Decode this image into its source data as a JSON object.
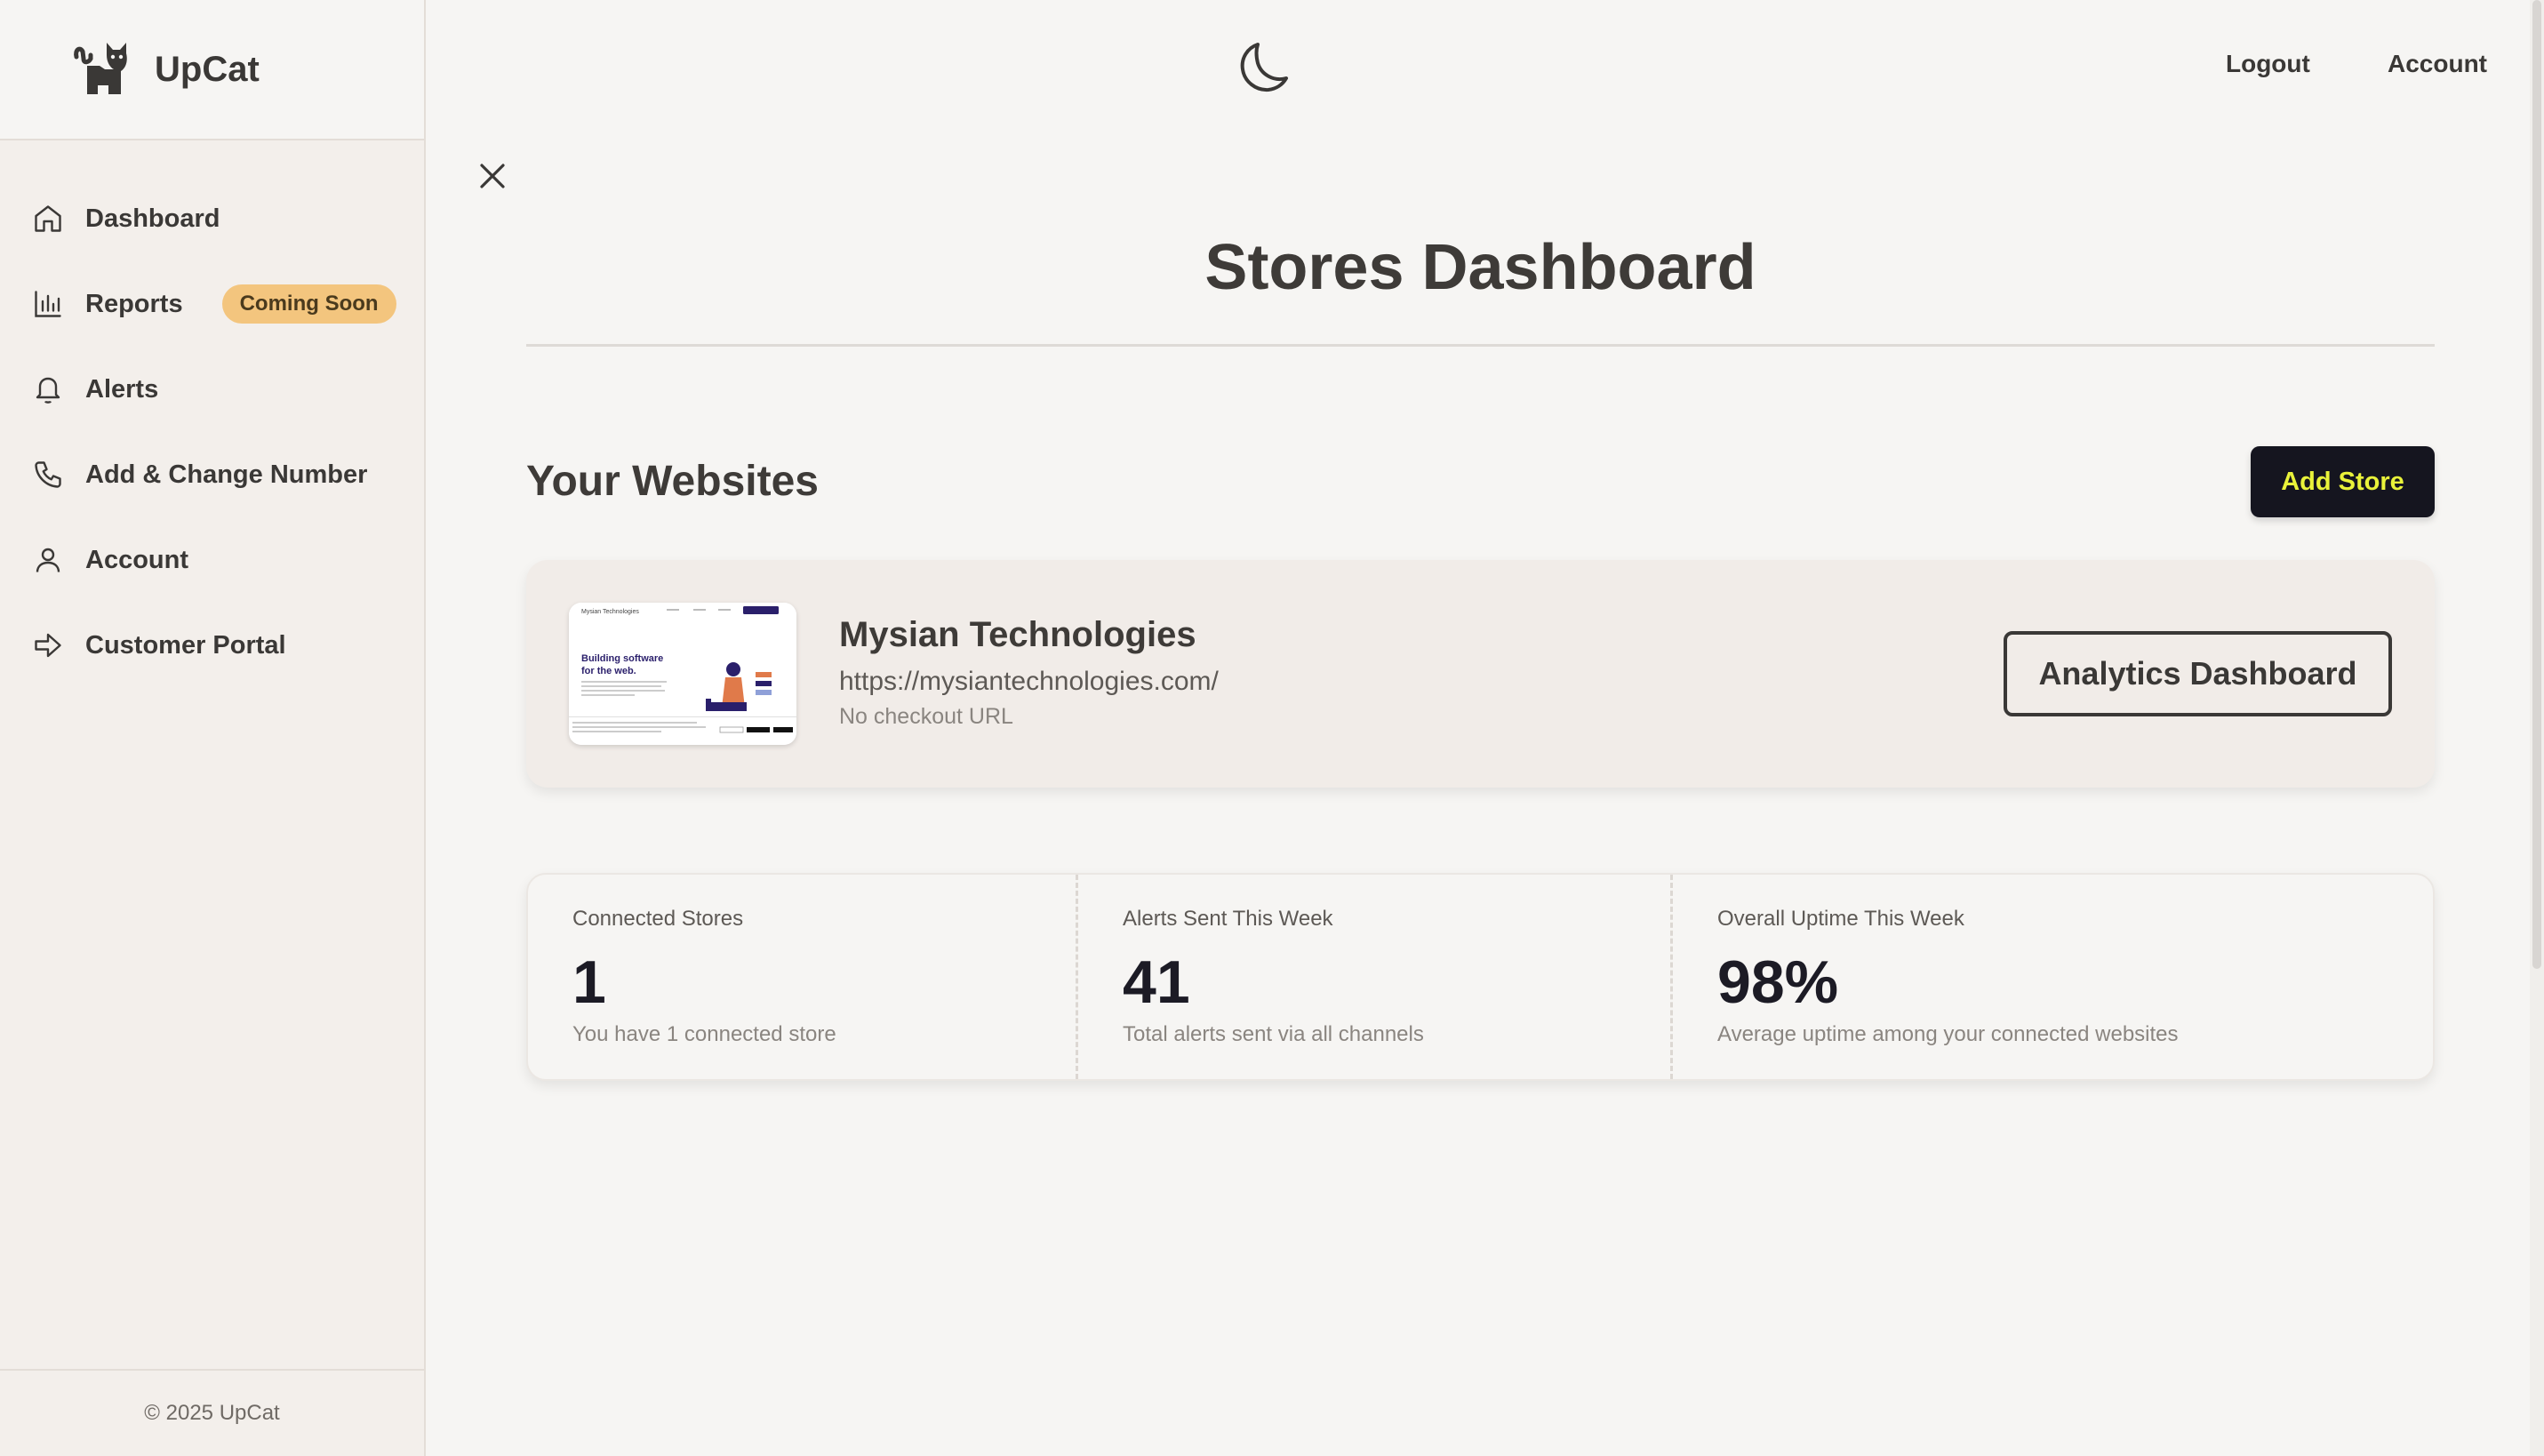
{
  "brand": {
    "name": "UpCat",
    "logo_icon": "cat-logo-icon"
  },
  "sidebar": {
    "items": [
      {
        "label": "Dashboard",
        "icon": "home-icon"
      },
      {
        "label": "Reports",
        "icon": "bar-chart-icon",
        "badge": "Coming Soon"
      },
      {
        "label": "Alerts",
        "icon": "bell-icon"
      },
      {
        "label": "Add & Change Number",
        "icon": "phone-icon"
      },
      {
        "label": "Account",
        "icon": "user-icon"
      },
      {
        "label": "Customer Portal",
        "icon": "arrow-right-icon"
      }
    ],
    "footer": "© 2025 UpCat"
  },
  "header": {
    "theme_icon": "moon-icon",
    "logout_label": "Logout",
    "account_label": "Account"
  },
  "main": {
    "title": "Stores Dashboard",
    "section_title": "Your Websites",
    "add_store_label": "Add Store"
  },
  "store": {
    "name": "Mysian Technologies",
    "url": "https://mysiantechnologies.com/",
    "checkout": "No checkout URL",
    "analytics_label": "Analytics Dashboard",
    "thumbnail": {
      "site_name": "Mysian Technologies",
      "headline": "Building software",
      "headline2": "for the web."
    }
  },
  "stats": [
    {
      "label": "Connected Stores",
      "value": "1",
      "desc": "You have 1 connected store"
    },
    {
      "label": "Alerts Sent This Week",
      "value": "41",
      "desc": "Total alerts sent via all channels"
    },
    {
      "label": "Overall Uptime This Week",
      "value": "98%",
      "desc": "Average uptime among your connected websites"
    }
  ],
  "colors": {
    "background": "#f6f5f3",
    "sidebar": "#f3efeb",
    "badge": "#f3c57e",
    "primary_button": "#15151f",
    "primary_button_text": "#e9f23a"
  }
}
